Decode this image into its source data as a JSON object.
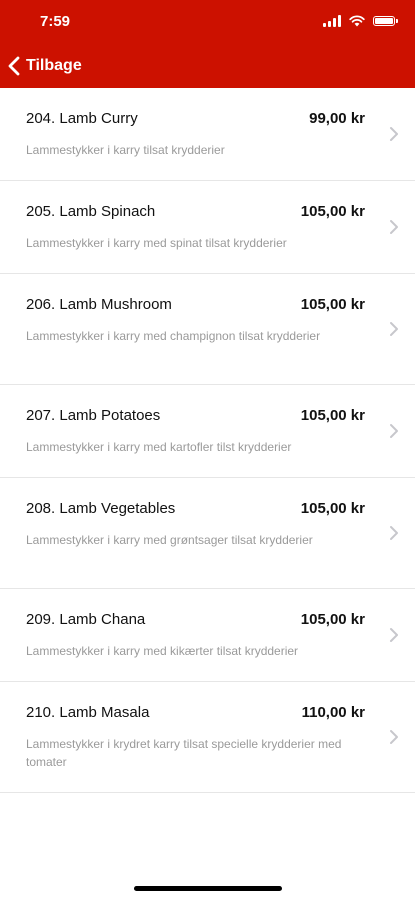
{
  "status_bar": {
    "time": "7:59"
  },
  "nav": {
    "back_label": "Tilbage"
  },
  "items": [
    {
      "name": "204. Lamb Curry",
      "price": "99,00 kr",
      "description": "Lammestykker i karry tilsat krydderier"
    },
    {
      "name": "205. Lamb Spinach",
      "price": "105,00 kr",
      "description": "Lammestykker i karry med spinat tilsat krydderier"
    },
    {
      "name": "206. Lamb Mushroom",
      "price": "105,00 kr",
      "description": "Lammestykker i karry med champignon tilsat krydderier"
    },
    {
      "name": "207. Lamb Potatoes",
      "price": "105,00 kr",
      "description": "Lammestykker i karry med kartofler tilst krydderier"
    },
    {
      "name": "208. Lamb Vegetables",
      "price": "105,00 kr",
      "description": "Lammestykker i karry med grøntsager tilsat krydderier"
    },
    {
      "name": "209. Lamb Chana",
      "price": "105,00 kr",
      "description": "Lammestykker i karry med kikærter tilsat krydderier"
    },
    {
      "name": "210. Lamb Masala",
      "price": "110,00 kr",
      "description": "Lammestykker i krydret karry tilsat specielle krydderier med tomater"
    }
  ],
  "colors": {
    "header": "#cc1100",
    "chevron": "#c7c7cc",
    "description": "#9a9a9a"
  },
  "icons": {
    "back": "chevron-left-icon",
    "row": "chevron-right-icon",
    "wifi": "wifi-icon",
    "signal": "signal-icon",
    "battery": "battery-icon"
  }
}
